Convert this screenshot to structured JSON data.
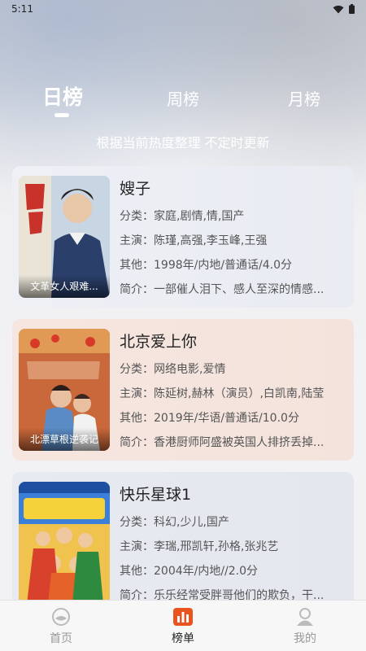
{
  "status_bar": {
    "time": "5:11"
  },
  "tabs": {
    "day": "日榜",
    "week": "周榜",
    "month": "月榜"
  },
  "subtitle": "根据当前热度整理 不定时更新",
  "items": [
    {
      "title": "嫂子",
      "poster_caption": "文革女人艰难...",
      "category": "分类：家庭,剧情,情,国产",
      "cast": "主演：陈瑾,高强,李玉峰,王强",
      "other": "其他：1998年/内地/普通话/4.0分",
      "summary": "简介：一部催人泪下、感人至深的情感..."
    },
    {
      "title": "北京爱上你",
      "poster_caption": "北漂草根逆袭记",
      "category": "分类：网络电影,爱情",
      "cast": "主演：陈延树,赫林（演员）,白凯南,陆莹",
      "other": "其他：2019年/华语/普通话/10.0分",
      "summary": "简介：香港厨师阿盛被英国人排挤丢掉..."
    },
    {
      "title": "快乐星球1",
      "poster_caption": "",
      "category": "分类：科幻,少儿,国产",
      "cast": "主演：李瑞,邢凯轩,孙格,张兆艺",
      "other": "其他：2004年/内地//2.0分",
      "summary": "简介：乐乐经常受胖哥他们的欺负，干..."
    }
  ],
  "bottom_nav": {
    "home": "首页",
    "chart": "榜单",
    "mine": "我的"
  },
  "colors": {
    "accent_nav_icon": "#e8531e",
    "inactive": "#999999"
  }
}
